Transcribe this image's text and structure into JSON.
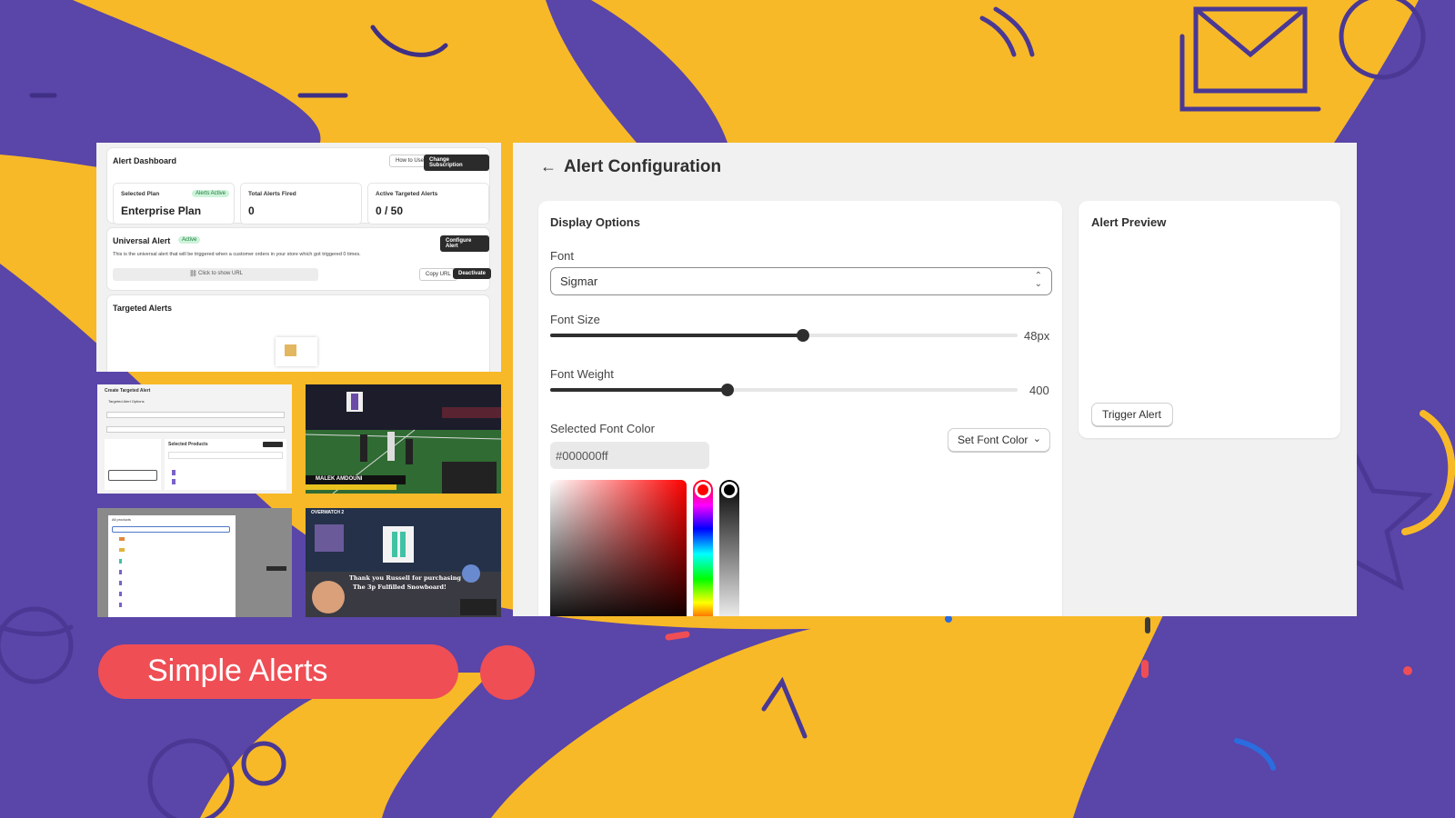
{
  "colors": {
    "purple": "#5a45a8",
    "yellow": "#f7b928",
    "red": "#ef4e55",
    "ink": "#303030"
  },
  "dashboard": {
    "title": "Alert Dashboard",
    "how_to_use": "How to Use",
    "change_subscription": "Change Subscription",
    "stats": [
      {
        "label": "Selected Plan",
        "value": "Enterprise Plan",
        "badge": "Alerts Active"
      },
      {
        "label": "Total Alerts Fired",
        "value": "0"
      },
      {
        "label": "Active Targeted Alerts",
        "value": "0 / 50"
      }
    ],
    "universal": {
      "title": "Universal Alert",
      "badge": "Active",
      "configure": "Configure Alert",
      "description": "This is the universal alert that will be triggered when a customer orders in your store which got triggered 0 times.",
      "url_placeholder": "Click to show URL",
      "copy_url": "Copy URL",
      "deactivate": "Deactivate"
    },
    "targeted_title": "Targeted Alerts"
  },
  "thumbnails": {
    "create_targeted": {
      "title": "Create Targeted Alert",
      "subtitle": "Targeted Alert Options",
      "selected_products": "Selected Products"
    },
    "stream": {
      "player": "MALEK AMDOUNI"
    },
    "products_list": {
      "title": "All products"
    },
    "game": {
      "brand": "OVERWATCH 2",
      "message_1": "Thank you Russell for purchasing",
      "message_2": "The 3p Fulfilled Snowboard!"
    }
  },
  "config": {
    "title": "Alert Configuration",
    "display_options": "Display Options",
    "font_label": "Font",
    "font_value": "Sigmar",
    "font_size_label": "Font Size",
    "font_size_value": "48px",
    "font_size_fraction": 0.54,
    "font_weight_label": "Font Weight",
    "font_weight_value": "400",
    "font_weight_fraction": 0.38,
    "selected_color_label": "Selected Font Color",
    "selected_color_value": "#000000ff",
    "set_color_button": "Set Font Color",
    "preview_title": "Alert Preview",
    "trigger_button": "Trigger Alert"
  },
  "banner": {
    "label": "Simple Alerts"
  }
}
